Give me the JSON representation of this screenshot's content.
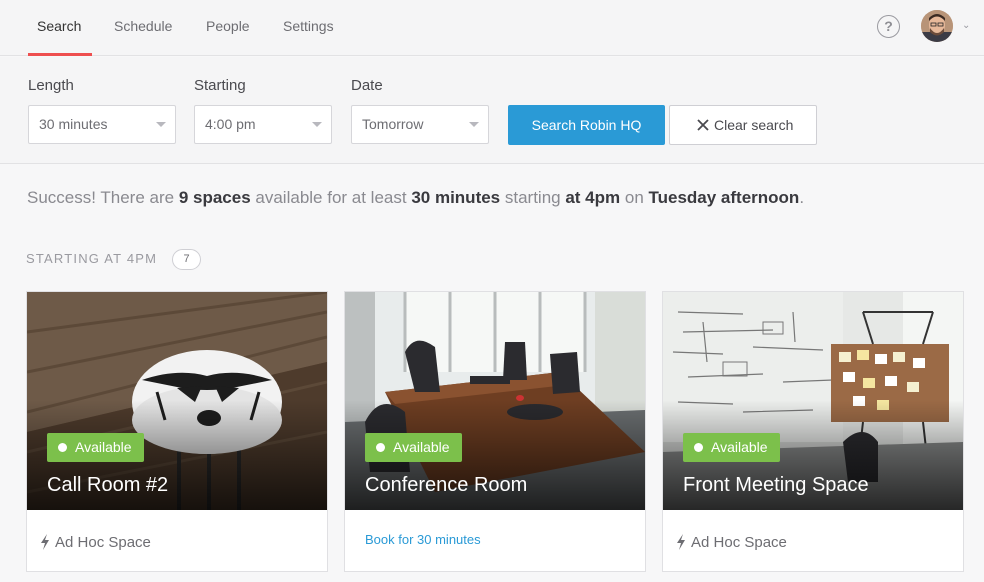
{
  "nav": {
    "tabs": [
      {
        "label": "Search",
        "active": true
      },
      {
        "label": "Schedule"
      },
      {
        "label": "People"
      },
      {
        "label": "Settings"
      }
    ],
    "help": "?",
    "accent_color": "#ee4f4f"
  },
  "filters": {
    "length": {
      "label": "Length",
      "value": "30 minutes"
    },
    "starting": {
      "label": "Starting",
      "value": "4:00 pm"
    },
    "date": {
      "label": "Date",
      "value": "Tomorrow"
    },
    "search_button": "Search Robin HQ",
    "clear_button": "Clear search",
    "primary_color": "#2a9ad6"
  },
  "summary": {
    "prefix": "Success! There are ",
    "spaces": "9 spaces",
    "mid1": " available for at least ",
    "duration": "30 minutes",
    "mid2": " starting ",
    "time": "at 4pm",
    "mid3": " on ",
    "day": "Tuesday afternoon",
    "suffix": "."
  },
  "section": {
    "heading": "STARTING AT 4PM",
    "count": "7"
  },
  "cards": [
    {
      "name": "Call Room #2",
      "status": "Available",
      "footer": "Ad Hoc Space",
      "icon": "lightning-icon"
    },
    {
      "name": "Conference Room",
      "status": "Available",
      "footer": "Book for 30 minutes"
    },
    {
      "name": "Front Meeting Space",
      "status": "Available",
      "footer": "Ad Hoc Space",
      "icon": "lightning-icon"
    }
  ],
  "status_color": "#7cc04b"
}
